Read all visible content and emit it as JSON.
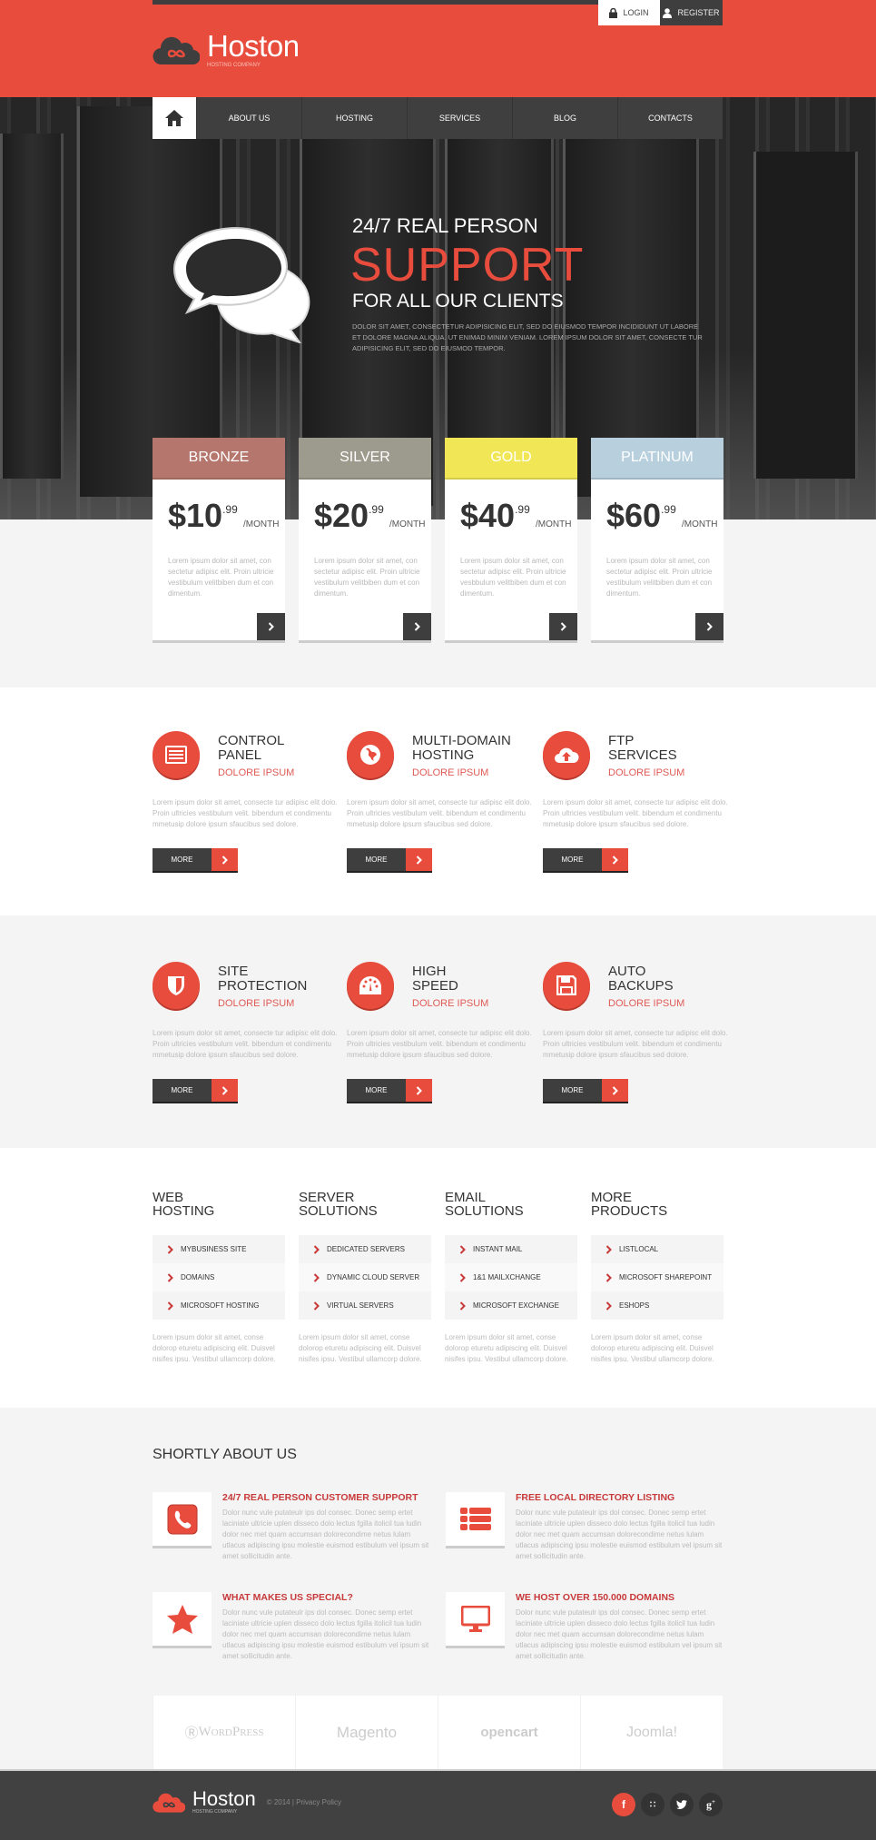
{
  "colors": {
    "accent": "#e84c3d",
    "dark": "#3e3e3e",
    "bronze": "#b5776d",
    "silver": "#9d9b8d",
    "gold": "#f1e756",
    "platinum": "#b8d0dd"
  },
  "header": {
    "login": "LOGIN",
    "register": "REGISTER",
    "brand": "Hoston",
    "tagline": "HOSTING COMPANY"
  },
  "nav": {
    "home_icon": "home-icon",
    "items": [
      "ABOUT US",
      "HOSTING",
      "SERVICES",
      "BLOG",
      "CONTACTS"
    ]
  },
  "hero": {
    "line1": "24/7 REAL PERSON",
    "line2": "SUPPORT",
    "line3": "FOR ALL OUR CLIENTS",
    "text": "DOLOR SIT AMET, CONSECTETUR ADIPISICING ELIT, SED DO EIUSMOD TEMPOR INCIDIDUNT UT LABORE ET DOLORE MAGNA ALIQUA. UT ENIMAD MINIM VENIAM. LOREM IPSUM DOLOR SIT AMET, CONSECTE TUR ADIPISICING ELIT, SED DO EIUSMOD TEMPOR."
  },
  "pricing": [
    {
      "name": "BRONZE",
      "dollars": "$10",
      "cents": ".99",
      "period": "/MONTH",
      "text": "Lorem ipsum dolor sit amet, con sectetur adipisc elit. Proin ultricie vestibulum velitbiben dum et con dimentum."
    },
    {
      "name": "SILVER",
      "dollars": "$20",
      "cents": ".99",
      "period": "/MONTH",
      "text": "Lorem ipsum dolor sit amet, con sectetur adipisc elit. Proin ultricie vestibulum velitbiben dum et con dimentum."
    },
    {
      "name": "GOLD",
      "dollars": "$40",
      "cents": ".99",
      "period": "/MONTH",
      "text": "Lorem ipsum dolor sit amet, con sectetur adipisc elit. Proin ultricie vesbbulum velitbiben dum et con dimentum."
    },
    {
      "name": "PLATINUM",
      "dollars": "$60",
      "cents": ".99",
      "period": "/MONTH",
      "text": "Lorem ipsum dolor sit amet, con sectetur adipisc elit. Proin ultricie vestibulum velitbiben dum et con dimentum."
    }
  ],
  "features": [
    {
      "title1": "CONTROL",
      "title2": "PANEL",
      "sub": "DOLORE IPSUM",
      "icon": "control-panel-icon"
    },
    {
      "title1": "MULTI-DOMAIN",
      "title2": "HOSTING",
      "sub": "DOLORE IPSUM",
      "icon": "globe-icon"
    },
    {
      "title1": "FTP",
      "title2": "SERVICES",
      "sub": "DOLORE IPSUM",
      "icon": "cloud-upload-icon"
    },
    {
      "title1": "SITE",
      "title2": "PROTECTION",
      "sub": "DOLORE IPSUM",
      "icon": "shield-icon"
    },
    {
      "title1": "HIGH",
      "title2": "SPEED",
      "sub": "DOLORE IPSUM",
      "icon": "speedometer-icon"
    },
    {
      "title1": "AUTO",
      "title2": "BACKUPS",
      "sub": "DOLORE IPSUM",
      "icon": "floppy-disk-icon"
    }
  ],
  "feature_text": "Lorem ipsum dolor sit amet, consecte tur adipisc elit dolo. Proin ultricies vestibulum velit. bibendum et condimentu mmetusip dolore ipsum sfaucibus sed dolore.",
  "more_label": "MORE",
  "products": [
    {
      "title1": "WEB",
      "title2": "HOSTING",
      "links": [
        "MYBUSINESS SITE",
        "DOMAINS",
        "MICROSOFT HOSTING"
      ]
    },
    {
      "title1": "SERVER",
      "title2": "SOLUTIONS",
      "links": [
        "DEDICATED SERVERS",
        "DYNAMIC CLOUD SERVER",
        "VIRTUAL SERVERS"
      ]
    },
    {
      "title1": "EMAIL",
      "title2": "SOLUTIONS",
      "links": [
        "INSTANT MAIL",
        "1&1 MAILXCHANGE",
        "MICROSOFT EXCHANGE"
      ]
    },
    {
      "title1": "MORE",
      "title2": "PRODUCTS",
      "links": [
        "LISTLOCAL",
        "MICROSOFT SHAREPOINT",
        "ESHOPS"
      ]
    }
  ],
  "product_text": "Lorem ipsum dolor sit amet, conse dolorop eturetu adipiscing elit. Duisvel nisifes ipsu. Vestibul ullamcorp dolore.",
  "about": {
    "title": "SHORTLY ABOUT US",
    "items": [
      {
        "title": "24/7 REAL PERSON CUSTOMER SUPPORT",
        "icon": "phone-icon"
      },
      {
        "title": "FREE LOCAL DIRECTORY LISTING",
        "icon": "list-icon"
      },
      {
        "title": "WHAT MAKES US SPECIAL?",
        "icon": "star-icon"
      },
      {
        "title": "WE HOST OVER 150.000 DOMAINS",
        "icon": "monitor-icon"
      }
    ],
    "text": "Dolor nunc vule putateulr ips dol consec. Donec semp ertet laciniate ultricie uplen disseco dolo lectus fgilla itolicil tua ludin dolor nec met quam accumsan dolorecondime netus lulam utlacus adipiscing ipsu molestie euismod estibulum vel ipsum sit amet sollicitudin ante."
  },
  "partners": [
    "WordPress",
    "Magento",
    "opencart",
    "Joomla!"
  ],
  "footer": {
    "brand": "Hoston",
    "tagline": "HOSTING COMPANY",
    "copyright": "© 2014 | Privacy Policy",
    "social": [
      "facebook-icon",
      "rss-icon",
      "twitter-icon",
      "google-plus-icon"
    ]
  }
}
